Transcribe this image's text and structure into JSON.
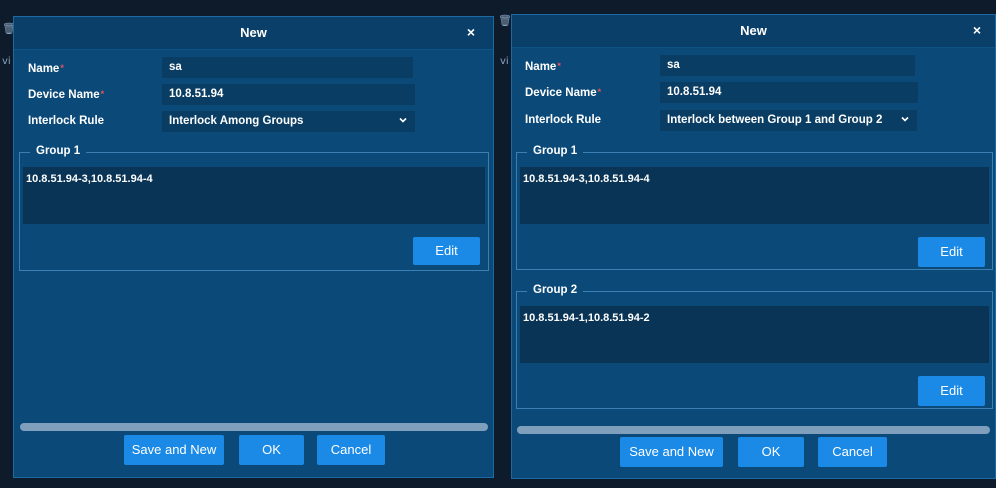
{
  "left_dialog": {
    "title": "New",
    "close_icon": "×",
    "name_label": "Name",
    "name_value": "sa",
    "device_label": "Device Name",
    "device_value": "10.8.51.94",
    "rule_label": "Interlock Rule",
    "rule_value": "Interlock Among Groups",
    "groups": [
      {
        "legend": "Group 1",
        "members": "10.8.51.94-3,10.8.51.94-4",
        "edit_label": "Edit"
      }
    ],
    "save_new_label": "Save and New",
    "ok_label": "OK",
    "cancel_label": "Cancel"
  },
  "right_dialog": {
    "title": "New",
    "close_icon": "×",
    "name_label": "Name",
    "name_value": "sa",
    "device_label": "Device Name",
    "device_value": "10.8.51.94",
    "rule_label": "Interlock Rule",
    "rule_value": "Interlock between Group 1 and Group 2",
    "groups": [
      {
        "legend": "Group 1",
        "members": "10.8.51.94-3,10.8.51.94-4",
        "edit_label": "Edit"
      },
      {
        "legend": "Group 2",
        "members": "10.8.51.94-1,10.8.51.94-2",
        "edit_label": "Edit"
      }
    ],
    "save_new_label": "Save and New",
    "ok_label": "OK",
    "cancel_label": "Cancel"
  },
  "colors": {
    "dialog_bg": "#0b4a78",
    "header_bg": "#0a3f69",
    "field_bg": "#0a3d63",
    "button": "#1a8ae6",
    "required_asterisk": "#e8505b"
  },
  "icons": {
    "close": "close-icon",
    "dropdown": "chevron-down-icon"
  }
}
